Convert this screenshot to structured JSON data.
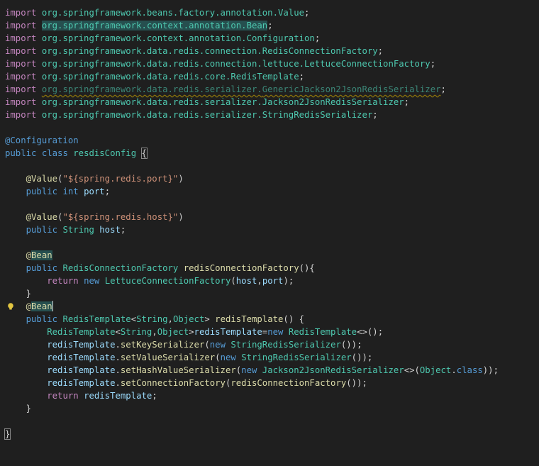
{
  "imports": [
    {
      "kw": "import",
      "pkg": "org.springframework.beans.factory.annotation.",
      "cls": "Value",
      "end": ";"
    },
    {
      "kw": "import",
      "pkg": "org.springframework.context.annotation.",
      "cls": "Bean",
      "end": ";"
    },
    {
      "kw": "import",
      "pkg": "org.springframework.context.annotation.",
      "cls": "Configuration",
      "end": ";"
    },
    {
      "kw": "import",
      "pkg": "org.springframework.data.redis.connection.",
      "cls": "RedisConnectionFactory",
      "end": ";"
    },
    {
      "kw": "import",
      "pkg": "org.springframework.data.redis.connection.lettuce.",
      "cls": "LettuceConnectionFactory",
      "end": ";"
    },
    {
      "kw": "import",
      "pkg": "org.springframework.data.redis.core.",
      "cls": "RedisTemplate",
      "end": ";"
    },
    {
      "kw": "import",
      "pkg": "org.springframework.data.redis.serializer.",
      "cls": "GenericJackson2JsonRedisSerializer",
      "end": ";"
    },
    {
      "kw": "import",
      "pkg": "org.springframework.data.redis.serializer.",
      "cls": "Jackson2JsonRedisSerializer",
      "end": ";"
    },
    {
      "kw": "import",
      "pkg": "org.springframework.data.redis.serializer.",
      "cls": "StringRedisSerializer",
      "end": ";"
    }
  ],
  "class_decl": {
    "annotation": "@Configuration",
    "public": "public",
    "class_kw": "class",
    "name": "resdisConfig",
    "open": "{"
  },
  "fields": {
    "port_annotation": "@Value",
    "port_value": "\"${spring.redis.port}\"",
    "port_decl": {
      "mod": "public",
      "type": "int",
      "name": "port"
    },
    "host_annotation": "@Value",
    "host_value": "\"${spring.redis.host}\"",
    "host_decl": {
      "mod": "public",
      "type": "String",
      "name": "host"
    }
  },
  "method1": {
    "at": "@",
    "bean": "Bean",
    "mod": "public",
    "rtype": "RedisConnectionFactory",
    "name": "redisConnectionFactory",
    "sig_end": "(){",
    "ret": "return",
    "new": "new",
    "ctor": "LettuceConnectionFactory",
    "arg1": "host",
    "arg2": "port",
    "close": "}"
  },
  "method2": {
    "at": "@",
    "bean": "Bean",
    "mod": "public",
    "rtype": "RedisTemplate",
    "gen1": "String",
    "gen2": "Object",
    "name": "redisTemplate",
    "sig_end": "() {",
    "decl_type": "RedisTemplate",
    "decl_var": "redisTemplate",
    "new": "new",
    "decl_ctor": "RedisTemplate",
    "var": "redisTemplate",
    "m_key": "setKeySerializer",
    "m_value": "setValueSerializer",
    "m_hash": "setHashValueSerializer",
    "m_conn": "setConnectionFactory",
    "ser_string": "StringRedisSerializer",
    "ser_jackson": "Jackson2JsonRedisSerializer",
    "obj": "Object",
    "class_kw": "class",
    "conn_call": "redisConnectionFactory",
    "ret": "return",
    "close": "}"
  },
  "class_close": "}"
}
